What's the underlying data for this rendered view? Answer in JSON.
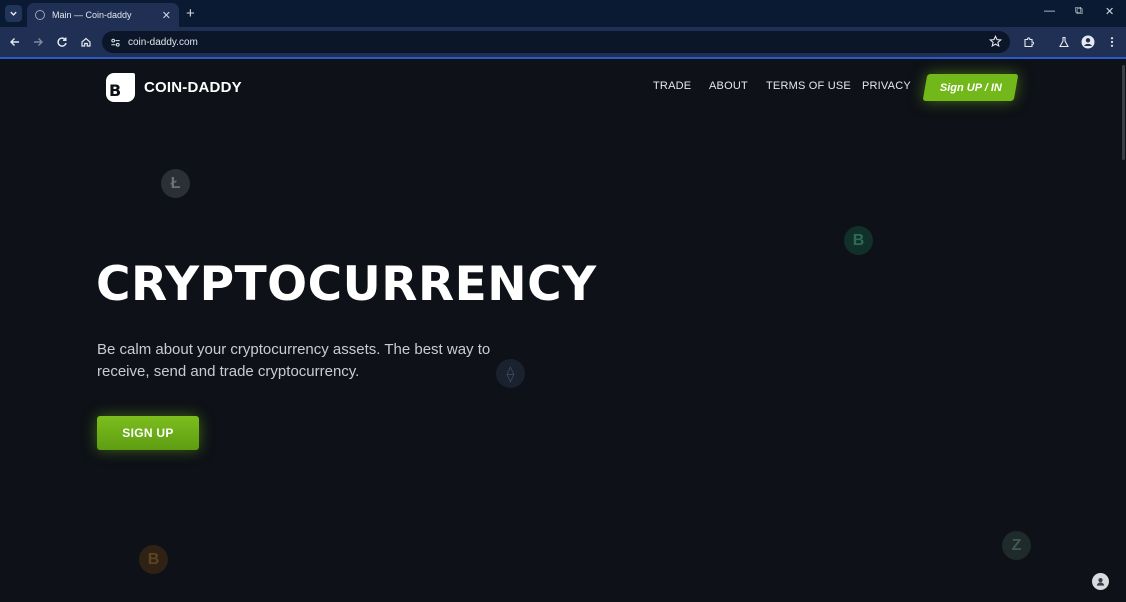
{
  "browser": {
    "tab_title": "Main — Coin-daddy",
    "new_tab_label": "+",
    "url": "coin-daddy.com",
    "window_controls": {
      "minimize": "—",
      "maximize": "⧉",
      "close": "✕"
    }
  },
  "site": {
    "logo_glyph": "B",
    "name": "COIN-DADDY",
    "nav": [
      "TRADE",
      "ABOUT",
      "TERMS OF USE",
      "PRIVACY"
    ],
    "cta": "Sign UP / IN"
  },
  "hero": {
    "title": "CRYPTOCURRENCY",
    "subtitle": "Be calm about your cryptocurrency assets. The best way to receive, send and trade cryptocurrency.",
    "button": "SIGN UP"
  },
  "coins": [
    {
      "symbol": "Ł",
      "icon": "litecoin-icon",
      "color": "#2b2f36",
      "text": "#6b7079"
    },
    {
      "symbol": "B",
      "icon": "bitcoin-green-icon",
      "color": "#12302a",
      "text": "#2f6a55"
    },
    {
      "symbol": "⟠",
      "icon": "ethereum-icon",
      "color": "#1a2230",
      "text": "#3d4a60"
    },
    {
      "symbol": "B",
      "icon": "bitcoin-orange-icon",
      "color": "#2f2215",
      "text": "#5f4422"
    },
    {
      "symbol": "Z",
      "icon": "zcash-icon",
      "color": "#1f2a2a",
      "text": "#3f5a55"
    }
  ],
  "colors": {
    "accent": "#72b81a",
    "background": "#0e1117",
    "chrome": "#1f3054"
  }
}
